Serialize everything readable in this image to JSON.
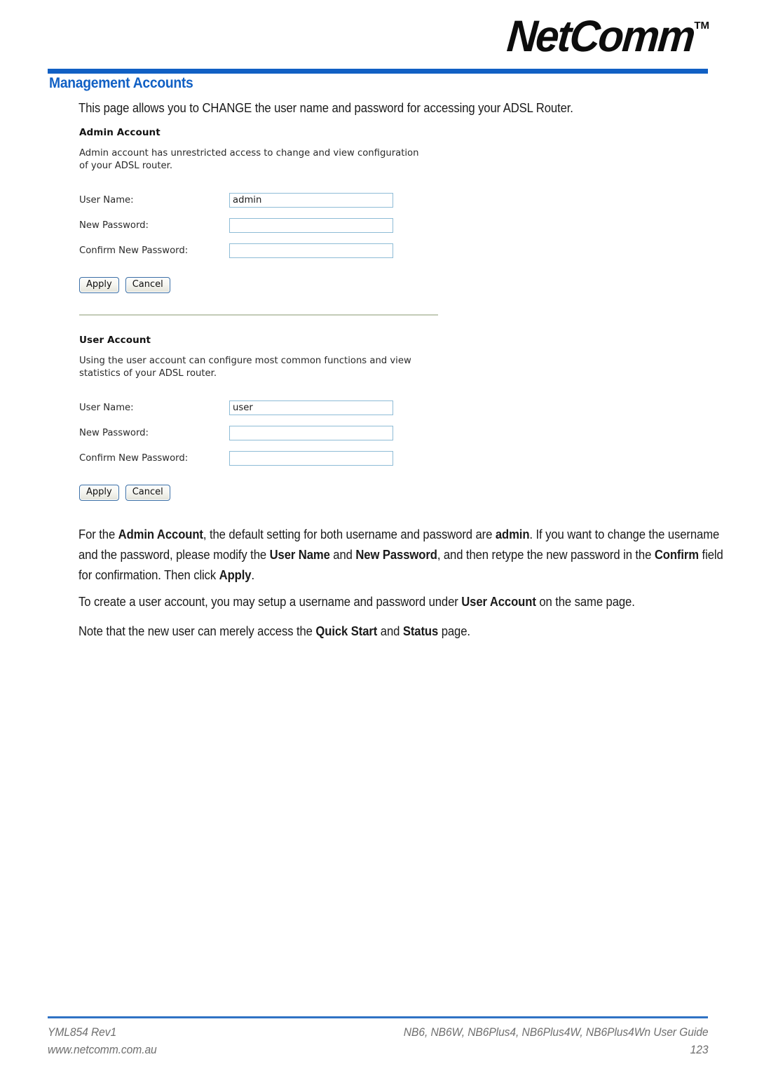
{
  "header": {
    "logo_text": "NetComm",
    "logo_tm": "TM",
    "rule_color": "#1160c4"
  },
  "page_title": "Management Accounts",
  "title_color": "#1160c4",
  "intro": "This page allows you to CHANGE the user name and password for accessing your ADSL Router.",
  "screenshot": {
    "admin": {
      "heading": "Admin Account",
      "description": "Admin account has unrestricted access to change and view configuration of your ADSL router.",
      "fields": [
        {
          "label": "User Name:",
          "value": "admin"
        },
        {
          "label": "New Password:",
          "value": ""
        },
        {
          "label": "Confirm New Password:",
          "value": ""
        }
      ],
      "apply_label": "Apply",
      "cancel_label": "Cancel"
    },
    "user": {
      "heading": "User Account",
      "description": "Using the user account can configure most common functions and view statistics of your ADSL router.",
      "fields": [
        {
          "label": "User Name:",
          "value": "user"
        },
        {
          "label": "New Password:",
          "value": ""
        },
        {
          "label": "Confirm New Password:",
          "value": ""
        }
      ],
      "apply_label": "Apply",
      "cancel_label": "Cancel"
    },
    "input_border_color": "#8ebcd6",
    "divider_color": "#c3cbb7"
  },
  "paragraphs": {
    "p1_runs": [
      {
        "t": "For the ",
        "b": false
      },
      {
        "t": "Admin Account",
        "b": true
      },
      {
        "t": ", the default setting for both username and password are ",
        "b": false
      },
      {
        "t": "admin",
        "b": true
      },
      {
        "t": ". If you want to change the username and the password, please modify the ",
        "b": false
      },
      {
        "t": "User Name",
        "b": true
      },
      {
        "t": " and ",
        "b": false
      },
      {
        "t": "New Password",
        "b": true
      },
      {
        "t": ", and then retype the new password in the ",
        "b": false
      },
      {
        "t": "Confirm",
        "b": true
      },
      {
        "t": " field for confirmation. Then click ",
        "b": false
      },
      {
        "t": "Apply",
        "b": true
      },
      {
        "t": ".",
        "b": false
      }
    ],
    "p2_runs": [
      {
        "t": "To create a user account, you may setup a username and password under ",
        "b": false
      },
      {
        "t": "User Account",
        "b": true
      },
      {
        "t": " on the same page.",
        "b": false
      }
    ],
    "p3_runs": [
      {
        "t": "Note that the new user can merely access the ",
        "b": false
      },
      {
        "t": "Quick Start",
        "b": true
      },
      {
        "t": " and ",
        "b": false
      },
      {
        "t": "Status",
        "b": true
      },
      {
        "t": " page.",
        "b": false
      }
    ]
  },
  "footer": {
    "doc_ref": "YML854 Rev1",
    "website": "www.netcomm.com.au",
    "guide_title": "NB6, NB6W, NB6Plus4, NB6Plus4W, NB6Plus4Wn User Guide",
    "page_number": "123",
    "rule_color": "#2f72c4"
  }
}
